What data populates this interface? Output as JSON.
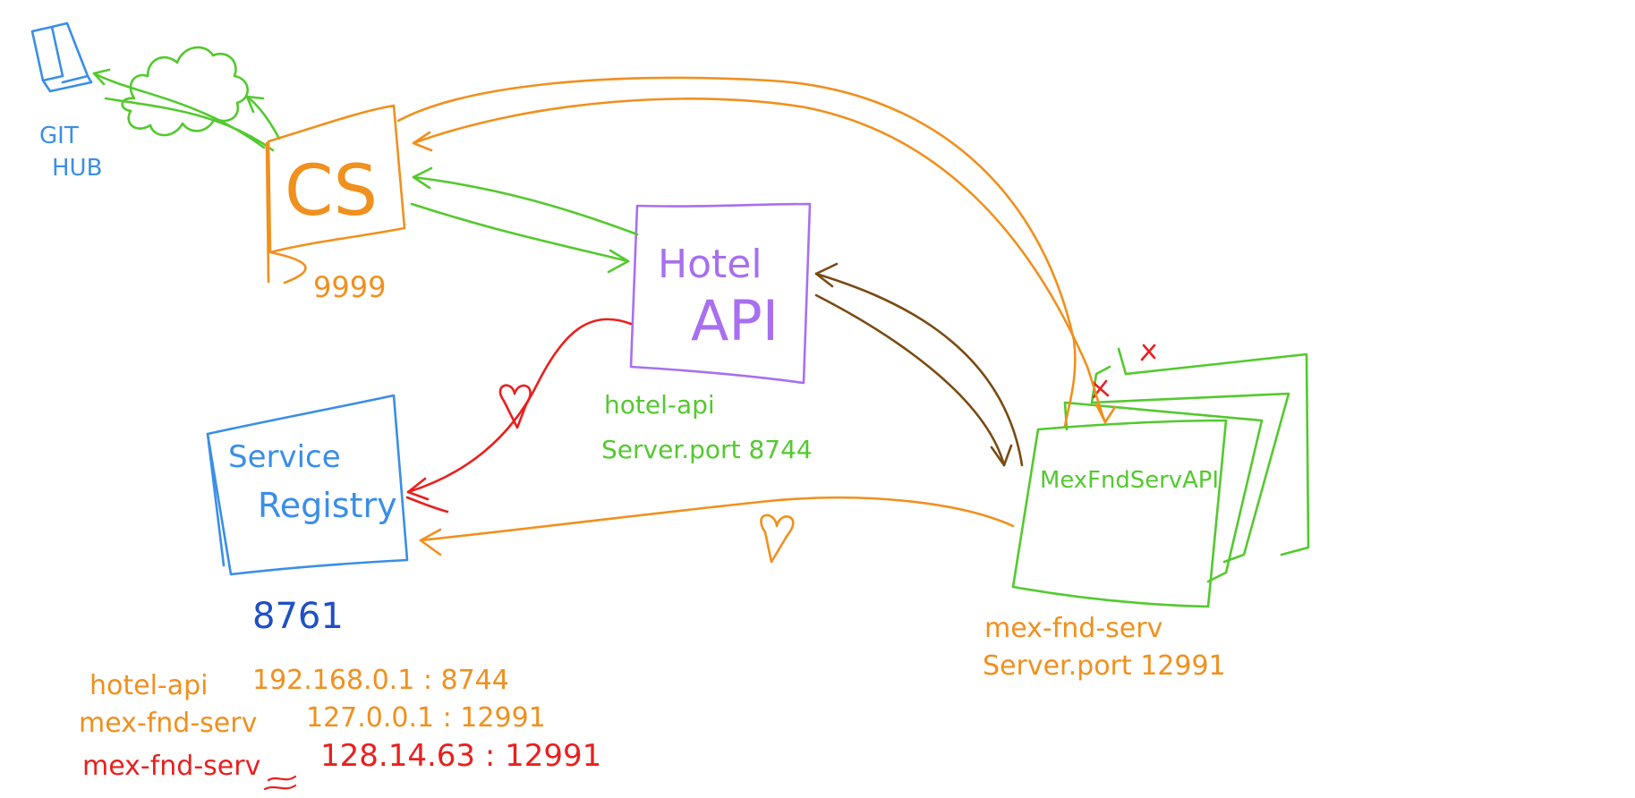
{
  "colors": {
    "github": "#3a8ee6",
    "config_server": "#f0901e",
    "hotel_api": "#a86ff0",
    "registry": "#3a8ee6",
    "registry_port": "#1f4fc4",
    "mex": "#53c92e",
    "heartbeat": "#e8201e",
    "brown": "#7a4a12",
    "cross": "#e8201e"
  },
  "github": {
    "label_line1": "GIT",
    "label_line2": "HUB",
    "icon": "github-icon"
  },
  "cloud": {
    "icon": "cloud-icon"
  },
  "config_server": {
    "label": "CS",
    "port": "9999"
  },
  "hotel_api": {
    "label_line1": "Hotel",
    "label_line2": "API",
    "name": "hotel-api",
    "port_text": "Server.port 8744"
  },
  "registry": {
    "label_line1": "Service",
    "label_line2": "Registry",
    "port": "8761"
  },
  "mex": {
    "label": "MexFndServAPI",
    "name": "mex-fnd-serv",
    "port_text": "Server.port 12991"
  },
  "registry_table": [
    {
      "name": "hotel-api",
      "address": "192.168.0.1 : 8744",
      "color": "#f0901e"
    },
    {
      "name": "mex-fnd-serv",
      "address": "127.0.0.1 : 12991",
      "color": "#f0901e"
    },
    {
      "name": "mex-fnd-serv",
      "address": "128.14.63 : 12991",
      "color": "#e8201e"
    }
  ]
}
